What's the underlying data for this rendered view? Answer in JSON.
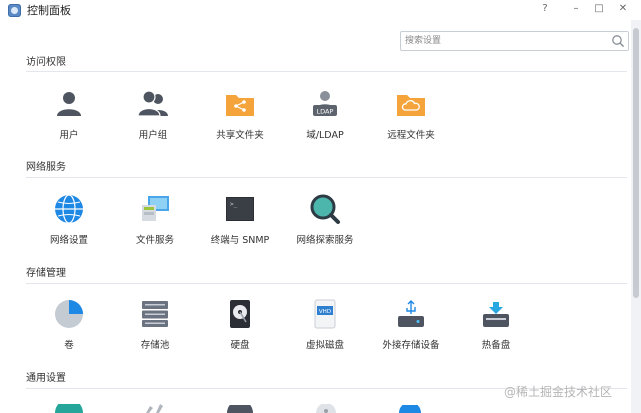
{
  "window": {
    "title": "控制面板",
    "help": "?",
    "minimize": "–",
    "maximize": "□",
    "close": "✕"
  },
  "search": {
    "placeholder": "搜索设置"
  },
  "sections": [
    {
      "title": "访问权限",
      "items": [
        {
          "label": "用户",
          "icon": "user-icon"
        },
        {
          "label": "用户组",
          "icon": "user-group-icon"
        },
        {
          "label": "共享文件夹",
          "icon": "share-folder-icon"
        },
        {
          "label": "域/LDAP",
          "icon": "ldap-icon"
        },
        {
          "label": "远程文件夹",
          "icon": "remote-folder-icon"
        }
      ]
    },
    {
      "title": "网络服务",
      "items": [
        {
          "label": "网络设置",
          "icon": "globe-icon"
        },
        {
          "label": "文件服务",
          "icon": "file-service-icon"
        },
        {
          "label": "终端与 SNMP",
          "icon": "terminal-icon"
        },
        {
          "label": "网络探索服务",
          "icon": "discovery-icon"
        }
      ]
    },
    {
      "title": "存储管理",
      "items": [
        {
          "label": "卷",
          "icon": "volume-pie-icon"
        },
        {
          "label": "存储池",
          "icon": "storage-pool-icon"
        },
        {
          "label": "硬盘",
          "icon": "hard-disk-icon"
        },
        {
          "label": "虚拟磁盘",
          "icon": "vhd-icon"
        },
        {
          "label": "外接存储设备",
          "icon": "usb-icon"
        },
        {
          "label": "热备盘",
          "icon": "hot-spare-icon"
        }
      ]
    },
    {
      "title": "通用设置",
      "items": []
    }
  ],
  "watermark": "@稀土掘金技术社区",
  "colors": {
    "accent_blue": "#1e88e5",
    "folder_orange": "#f5a33b",
    "icon_gray": "#4f5560"
  }
}
